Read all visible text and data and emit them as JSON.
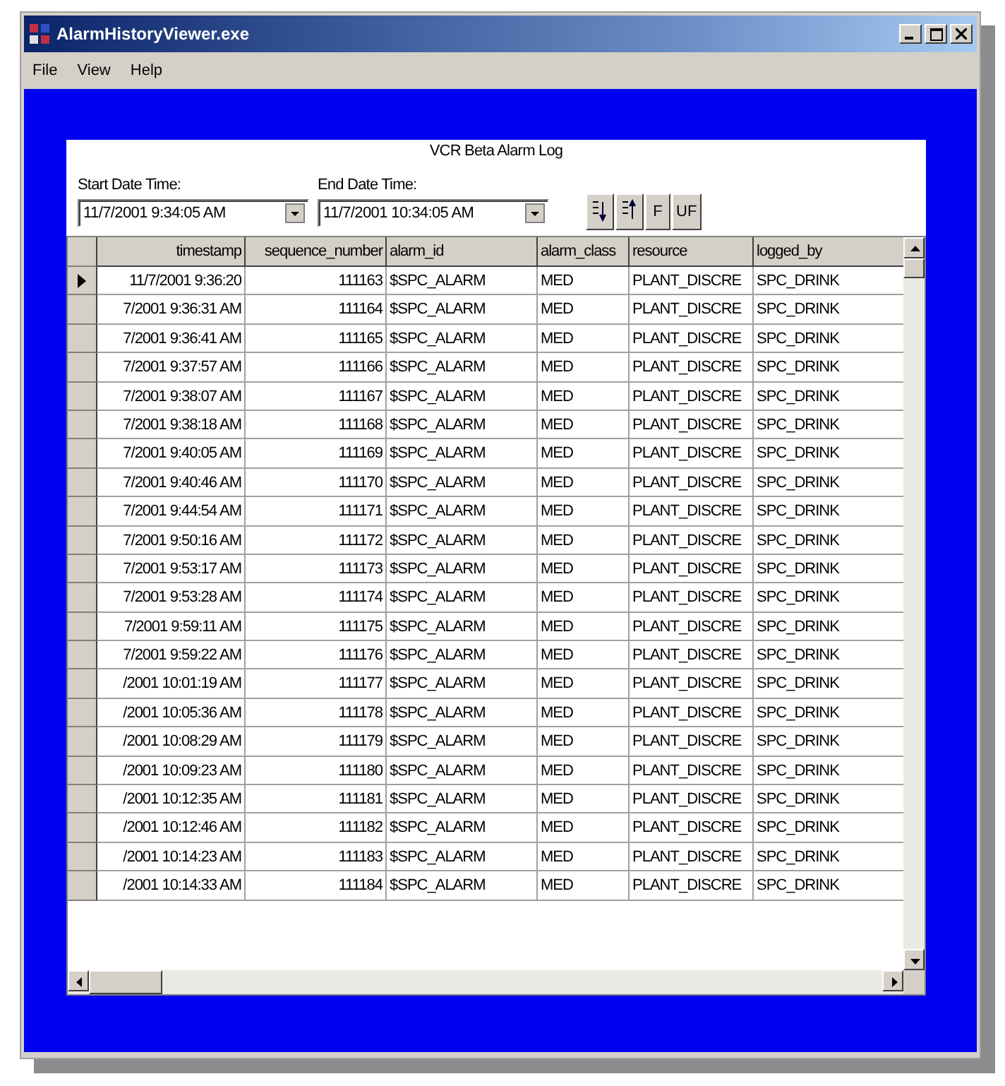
{
  "window": {
    "title": "AlarmHistoryViewer.exe"
  },
  "menu": [
    "File",
    "View",
    "Help"
  ],
  "panel": {
    "title": "VCR Beta Alarm Log",
    "start": {
      "label": "Start Date Time:",
      "value": "11/7/2001  9:34:05 AM"
    },
    "end": {
      "label": "End Date Time:",
      "value": "11/7/2001 10:34:05 AM"
    },
    "tools": [
      {
        "kind": "sort-asc"
      },
      {
        "kind": "sort-desc"
      },
      {
        "kind": "text",
        "label": "F"
      },
      {
        "kind": "text",
        "label": "UF"
      }
    ]
  },
  "table": {
    "columns": [
      "timestamp",
      "sequence_number",
      "alarm_id",
      "alarm_class",
      "resource",
      "logged_by"
    ],
    "rows": [
      {
        "current": true,
        "cells": [
          "11/7/2001 9:36:20",
          "111163",
          "$SPC_ALARM",
          "MED",
          "PLANT_DISCRE",
          "SPC_DRINK"
        ]
      },
      {
        "current": false,
        "cells": [
          "7/2001 9:36:31 AM",
          "111164",
          "$SPC_ALARM",
          "MED",
          "PLANT_DISCRE",
          "SPC_DRINK"
        ]
      },
      {
        "current": false,
        "cells": [
          "7/2001 9:36:41 AM",
          "111165",
          "$SPC_ALARM",
          "MED",
          "PLANT_DISCRE",
          "SPC_DRINK"
        ]
      },
      {
        "current": false,
        "cells": [
          "7/2001 9:37:57 AM",
          "111166",
          "$SPC_ALARM",
          "MED",
          "PLANT_DISCRE",
          "SPC_DRINK"
        ]
      },
      {
        "current": false,
        "cells": [
          "7/2001 9:38:07 AM",
          "111167",
          "$SPC_ALARM",
          "MED",
          "PLANT_DISCRE",
          "SPC_DRINK"
        ]
      },
      {
        "current": false,
        "cells": [
          "7/2001 9:38:18 AM",
          "111168",
          "$SPC_ALARM",
          "MED",
          "PLANT_DISCRE",
          "SPC_DRINK"
        ]
      },
      {
        "current": false,
        "cells": [
          "7/2001 9:40:05 AM",
          "111169",
          "$SPC_ALARM",
          "MED",
          "PLANT_DISCRE",
          "SPC_DRINK"
        ]
      },
      {
        "current": false,
        "cells": [
          "7/2001 9:40:46 AM",
          "111170",
          "$SPC_ALARM",
          "MED",
          "PLANT_DISCRE",
          "SPC_DRINK"
        ]
      },
      {
        "current": false,
        "cells": [
          "7/2001 9:44:54 AM",
          "111171",
          "$SPC_ALARM",
          "MED",
          "PLANT_DISCRE",
          "SPC_DRINK"
        ]
      },
      {
        "current": false,
        "cells": [
          "7/2001 9:50:16 AM",
          "111172",
          "$SPC_ALARM",
          "MED",
          "PLANT_DISCRE",
          "SPC_DRINK"
        ]
      },
      {
        "current": false,
        "cells": [
          "7/2001 9:53:17 AM",
          "111173",
          "$SPC_ALARM",
          "MED",
          "PLANT_DISCRE",
          "SPC_DRINK"
        ]
      },
      {
        "current": false,
        "cells": [
          "7/2001 9:53:28 AM",
          "111174",
          "$SPC_ALARM",
          "MED",
          "PLANT_DISCRE",
          "SPC_DRINK"
        ]
      },
      {
        "current": false,
        "cells": [
          "7/2001 9:59:11 AM",
          "111175",
          "$SPC_ALARM",
          "MED",
          "PLANT_DISCRE",
          "SPC_DRINK"
        ]
      },
      {
        "current": false,
        "cells": [
          "7/2001 9:59:22 AM",
          "111176",
          "$SPC_ALARM",
          "MED",
          "PLANT_DISCRE",
          "SPC_DRINK"
        ]
      },
      {
        "current": false,
        "cells": [
          "/2001 10:01:19 AM",
          "111177",
          "$SPC_ALARM",
          "MED",
          "PLANT_DISCRE",
          "SPC_DRINK"
        ]
      },
      {
        "current": false,
        "cells": [
          "/2001 10:05:36 AM",
          "111178",
          "$SPC_ALARM",
          "MED",
          "PLANT_DISCRE",
          "SPC_DRINK"
        ]
      },
      {
        "current": false,
        "cells": [
          "/2001 10:08:29 AM",
          "111179",
          "$SPC_ALARM",
          "MED",
          "PLANT_DISCRE",
          "SPC_DRINK"
        ]
      },
      {
        "current": false,
        "cells": [
          "/2001 10:09:23 AM",
          "111180",
          "$SPC_ALARM",
          "MED",
          "PLANT_DISCRE",
          "SPC_DRINK"
        ]
      },
      {
        "current": false,
        "cells": [
          "/2001 10:12:35 AM",
          "111181",
          "$SPC_ALARM",
          "MED",
          "PLANT_DISCRE",
          "SPC_DRINK"
        ]
      },
      {
        "current": false,
        "cells": [
          "/2001 10:12:46 AM",
          "111182",
          "$SPC_ALARM",
          "MED",
          "PLANT_DISCRE",
          "SPC_DRINK"
        ]
      },
      {
        "current": false,
        "cells": [
          "/2001 10:14:23 AM",
          "111183",
          "$SPC_ALARM",
          "MED",
          "PLANT_DISCRE",
          "SPC_DRINK"
        ]
      },
      {
        "current": false,
        "cells": [
          "/2001 10:14:33 AM",
          "111184",
          "$SPC_ALARM",
          "MED",
          "PLANT_DISCRE",
          "SPC_DRINK"
        ]
      }
    ]
  }
}
